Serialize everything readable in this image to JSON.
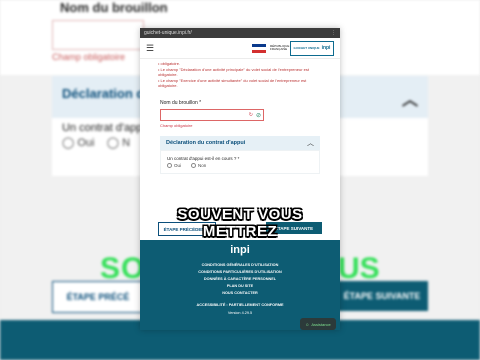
{
  "background": {
    "field_label": "Nom du brouillon",
    "field_error": "Champ obligatoire",
    "section_title": "Déclaration du c",
    "question": "Un contrat d'app",
    "radio_oui": "Oui",
    "radio_non": "N",
    "btn_prev": "ÉTAPE PRÉCÉ",
    "btn_next": "ÉTAPE SUIVANTE",
    "green_left": "SO",
    "green_right": "US"
  },
  "phone": {
    "url": "guichet-unique.inpi.fr/",
    "brand": "inpi",
    "brand_sub": "GUICHET UNIQUE",
    "gov_text": "RÉPUBLIQUE FRANÇAISE",
    "menu_icon": "hamburger-icon",
    "errors": [
      "obligatoire.",
      "Le champ \"Déclaration d'une activité principale\" du volet social de l'entrepreneur est obligatoire.",
      "Le champ \"Exercice d'une activité simultanée\" du volet social de l'entrepreneur est obligatoire."
    ],
    "field_label": "Nom du brouillon *",
    "field_error": "Champ obligatoire",
    "accordion_title": "Déclaration du contrat d'appui",
    "question": "Un contrat d'appui est-il en cours ? *",
    "radio_oui": "Oui",
    "radio_non": "Non",
    "btn_prev": "ÉTAPE PRÉCÉDENTE",
    "btn_next": "ÉTAPE SUIVANTE",
    "footer_logo": "inpi",
    "footer_links": [
      "CONDITIONS GÉNÉRALES D'UTILISATION",
      "CONDITIONS PARTICULIÈRES D'UTILISATION",
      "DONNÉES À CARACTÈRE PERSONNEL",
      "PLAN DU SITE",
      "NOUS CONTACTER"
    ],
    "footer_access": "ACCESSIBILITÉ : PARTIELLEMENT CONFORME",
    "footer_version": "Version 4.29.5",
    "fab_label": "Assistance"
  },
  "caption": {
    "line1": "SOUVENT VOUS",
    "line2": "METTREZ"
  },
  "colors": {
    "brand_teal": "#0d5c73",
    "error_red": "#c34444",
    "accent_green": "#36e05a"
  }
}
